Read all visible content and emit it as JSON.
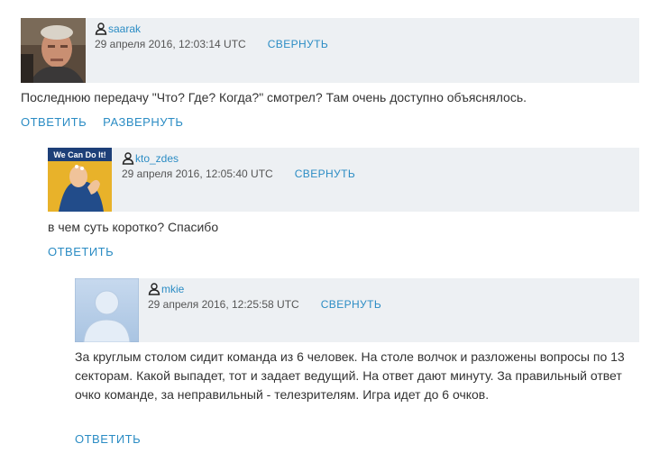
{
  "comments": [
    {
      "username": "saarak",
      "date": "29 апреля 2016, 12:03:14 UTC",
      "collapse_label": "СВЕРНУТЬ",
      "text": "Последнюю передачу \"Что? Где? Когда?\" смотрел? Там очень доступно объяснялось.",
      "reply_label": "ОТВЕТИТЬ",
      "expand_label": "РАЗВЕРНУТЬ",
      "avatar": "photo-of-man"
    },
    {
      "username": "kto_zdes",
      "date": "29 апреля 2016, 12:05:40 UTC",
      "collapse_label": "СВЕРНУТЬ",
      "text": "в чем суть коротко? Спасибо",
      "reply_label": "ОТВЕТИТЬ",
      "avatar": "we-can-do-it-poster",
      "avatar_caption": "We Can Do It!"
    },
    {
      "username": "mkie",
      "date": "29 апреля 2016, 12:25:58 UTC",
      "collapse_label": "СВЕРНУТЬ",
      "text": "За круглым столом сидит команда из 6 человек. На столе волчок и разложены вопросы по 13 секторам. Какой выпадет, тот и задает ведущий. На ответ дают минуту. За правильный ответ очко команде, за неправильный - телезрителям. Игра идет до 6 очков.",
      "reply_label": "ОТВЕТИТЬ",
      "avatar": "default-user-silhouette"
    }
  ],
  "colors": {
    "link": "#2b8cc4",
    "header_bg": "#edf0f3",
    "text": "#333333"
  }
}
